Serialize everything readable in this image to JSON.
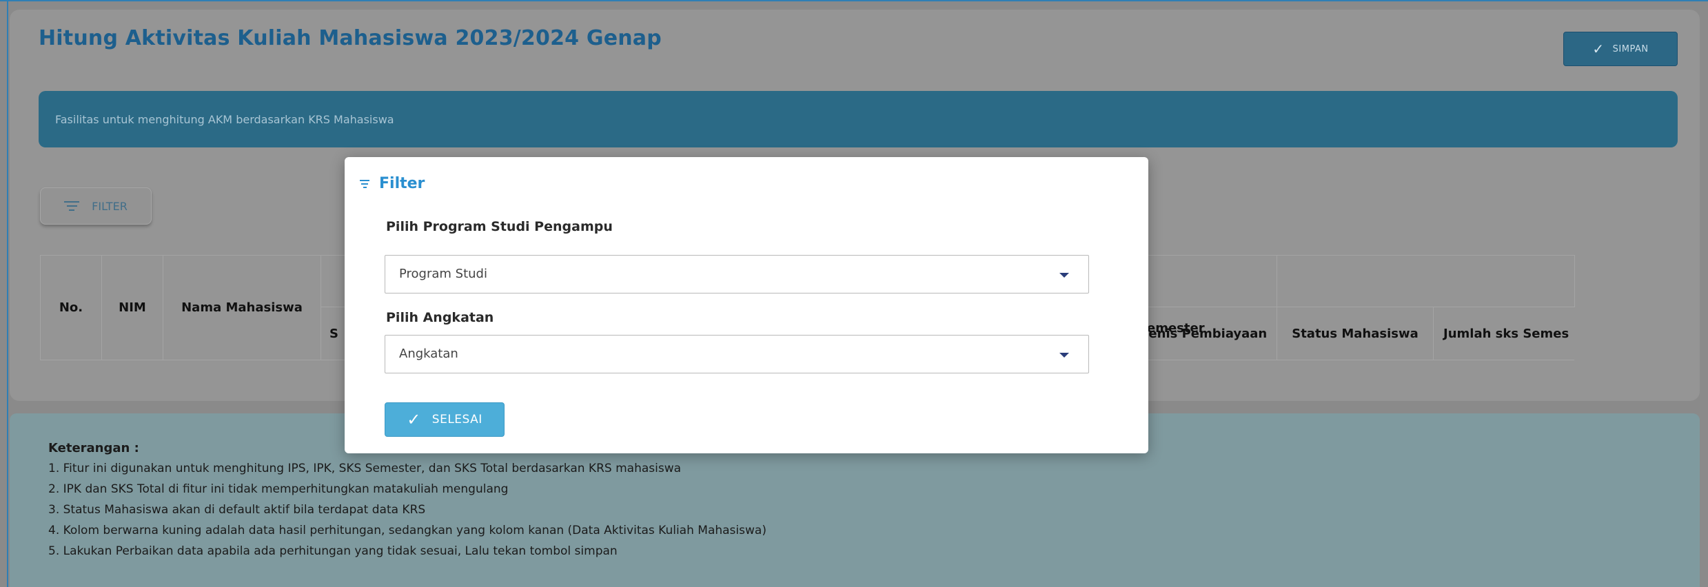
{
  "page": {
    "title": "Hitung Aktivitas Kuliah Mahasiswa 2023/2024 Genap",
    "save_label": "SIMPAN",
    "info_banner": "Fasilitas untuk menghitung AKM berdasarkan KRS Mahasiswa",
    "filter_label": "FILTER"
  },
  "table": {
    "headers": {
      "no": "No.",
      "nim": "NIM",
      "nama": "Nama Mahasiswa",
      "partial_s": "S",
      "semester_partial": "emester",
      "pembiayaan": "Jenis Pembiayaan",
      "status": "Status Mahasiswa",
      "jumlah_sks": "Jumlah sks Semes"
    }
  },
  "modal": {
    "title": "Filter",
    "prodi_label": "Pilih Program Studi Pengampu",
    "prodi_value": "Program Studi",
    "angkatan_label": "Pilih Angkatan",
    "angkatan_value": "Angkatan",
    "done_label": "SELESAI"
  },
  "notes": {
    "title": "Keterangan :",
    "items": [
      "1. Fitur ini digunakan untuk menghitung IPS, IPK, SKS Semester, dan SKS Total berdasarkan KRS mahasiswa",
      "2. IPK dan SKS Total di fitur ini tidak memperhitungkan matakuliah mengulang",
      "3. Status Mahasiswa akan di default aktif bila terdapat data KRS",
      "4. Kolom berwarna kuning adalah data hasil perhitungan, sedangkan yang kolom kanan (Data Aktivitas Kuliah Mahasiswa)",
      "5. Lakukan Perbaikan data apabila ada perhitungan yang tidak sesuai, Lalu tekan tombol simpan"
    ]
  },
  "icons": {
    "save": "check-icon",
    "filter": "filter-icon",
    "caret": "caret-down-icon",
    "done": "check-icon"
  },
  "colors": {
    "title": "#1d5f8d",
    "banner": "#2b6a86",
    "modal_accent": "#2a8fd0",
    "done_button": "#4daed9",
    "overlay": "#8a8a8a"
  }
}
